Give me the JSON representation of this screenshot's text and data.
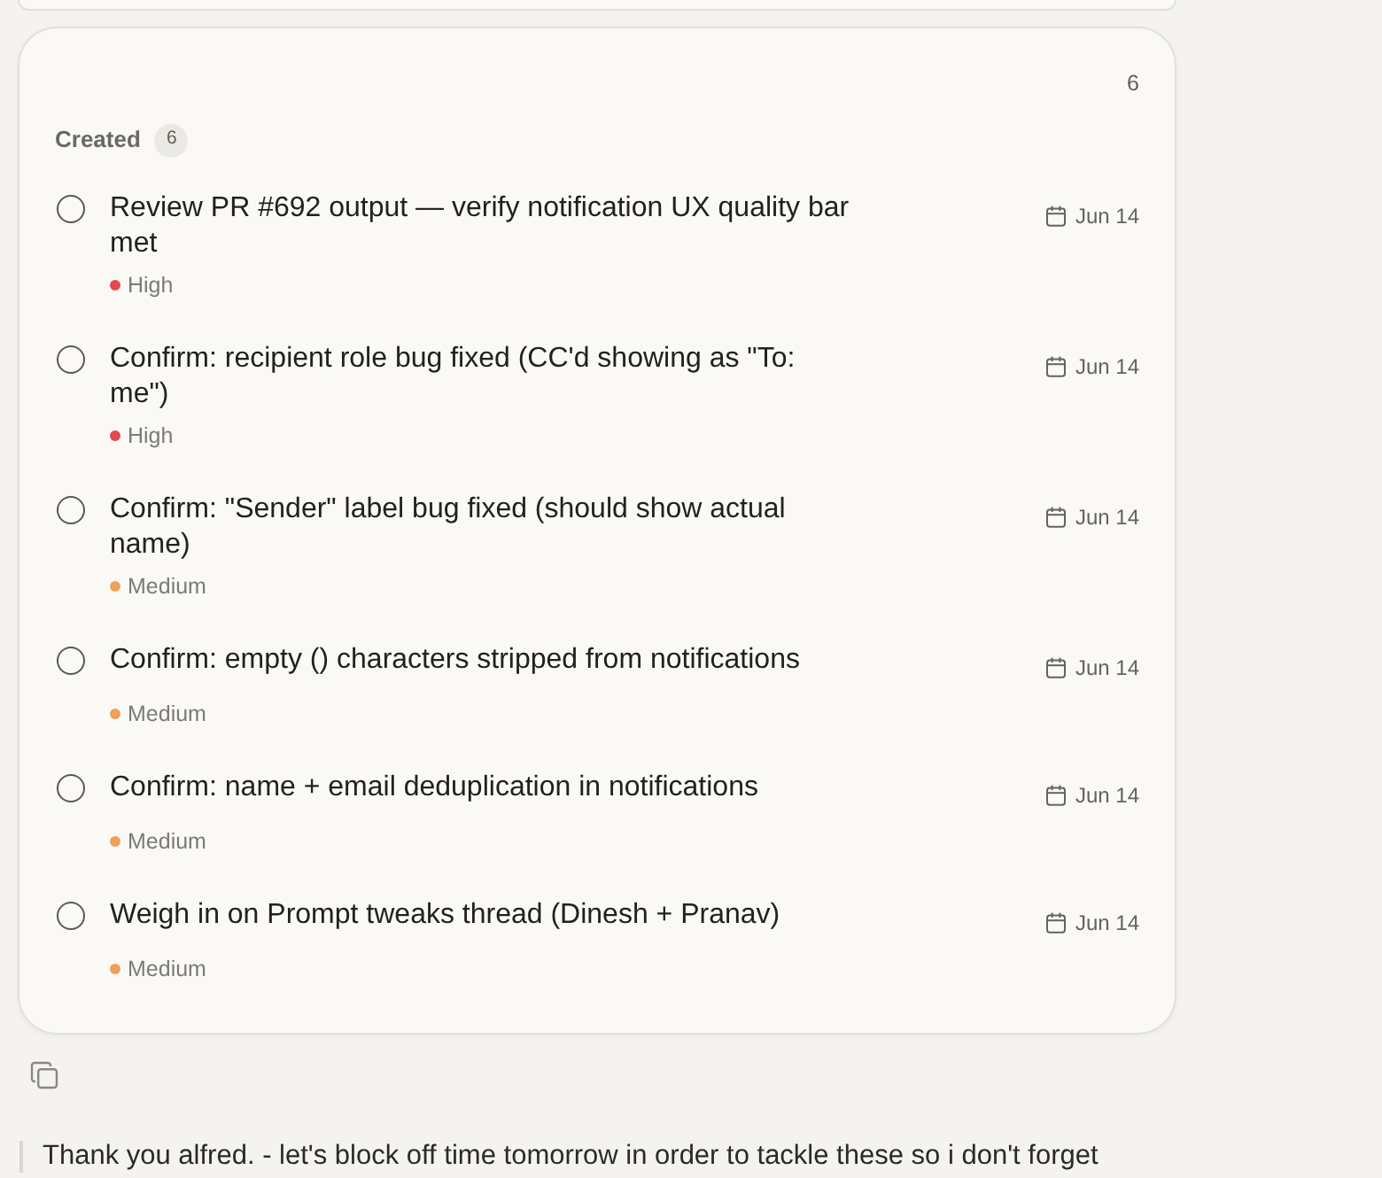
{
  "task_card": {
    "count": "6",
    "section": {
      "label": "Created",
      "count": "6"
    },
    "tasks": [
      {
        "title": "Review PR #692 output — verify notification UX quality bar met",
        "checked": false,
        "priority": {
          "label": "High",
          "color": "#e5484d"
        },
        "due": "Jun 14"
      },
      {
        "title": "Confirm: recipient role bug fixed (CC'd showing as \"To: me\")",
        "checked": false,
        "priority": {
          "label": "High",
          "color": "#e5484d"
        },
        "due": "Jun 14"
      },
      {
        "title": "Confirm: \"Sender\" label bug fixed (should show actual name)",
        "checked": false,
        "priority": {
          "label": "Medium",
          "color": "#f0a05a"
        },
        "due": "Jun 14"
      },
      {
        "title": "Confirm: empty () characters stripped from notifications",
        "checked": false,
        "priority": {
          "label": "Medium",
          "color": "#f0a05a"
        },
        "due": "Jun 14"
      },
      {
        "title": "Confirm: name + email deduplication in notifications",
        "checked": false,
        "priority": {
          "label": "Medium",
          "color": "#f0a05a"
        },
        "due": "Jun 14"
      },
      {
        "title": "Weigh in on Prompt tweaks thread (Dinesh + Pranav)",
        "checked": false,
        "priority": {
          "label": "Medium",
          "color": "#f0a05a"
        },
        "due": "Jun 14"
      }
    ]
  },
  "message": {
    "text": "Thank you alfred. - let's block off time tomorrow in order to tackle these so i don't forget"
  }
}
